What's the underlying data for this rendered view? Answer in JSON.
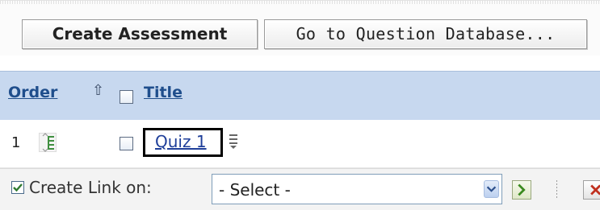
{
  "toolbar": {
    "create_label": "Create Assessment",
    "goto_label": "Go to Question Database..."
  },
  "table": {
    "headers": {
      "order": "Order",
      "title": "Title"
    },
    "rows": [
      {
        "order": "1",
        "title": "Quiz 1"
      }
    ]
  },
  "footer": {
    "label": "Create Link on:",
    "select_value": "- Select -"
  },
  "icons": {
    "sort": "sort-ascending-icon",
    "reorder": "reorder-icon",
    "menu": "context-menu-icon",
    "footer_check": "checked-checkbox-icon",
    "dropdown": "chevron-down-icon",
    "go": "go-arrow-icon",
    "delete": "delete-x-icon"
  },
  "colors": {
    "header_bg": "#c7d8ef",
    "link": "#1f4e8c",
    "highlight_border": "#000000"
  }
}
